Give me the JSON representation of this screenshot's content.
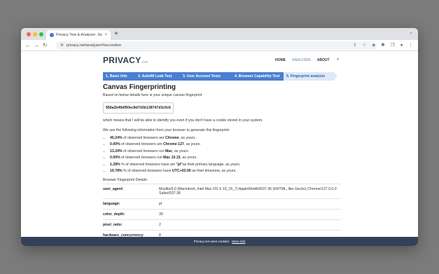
{
  "browser": {
    "tab_title": "Privacy Test & Analyzer: See",
    "tab_close": "×",
    "new_tab": "+",
    "tab_menu": "⌄",
    "back": "←",
    "forward": "→",
    "reload": "↻",
    "url": "privacy.net/analyzer/#accordion",
    "toolbar_icons": [
      "⇪",
      "☆",
      "◈",
      "✱",
      "❐",
      "●",
      "⋮"
    ]
  },
  "site": {
    "logo_main": "PRIVACY",
    "logo_suffix": ".net",
    "nav": [
      {
        "label": "HOME",
        "active": false
      },
      {
        "label": "ANALYZER",
        "active": true
      },
      {
        "label": "ABOUT",
        "active": false
      }
    ],
    "search_glyph": "⌕"
  },
  "steps": [
    "1. Basic Info",
    "2. Autofill Leak Test",
    "3. User Account Tests",
    "4. Browser Capability Test",
    "5. Fingerprint analysis"
  ],
  "content": {
    "title": "Canvas Fingerprinting",
    "intro": "Based on below details here is your unique canvas fingerprint",
    "hash": "956a2b49df50ec8d7d3b138747d3c0c6",
    "identify_note": "which means that I will be able to identify you even if you don't have a cookie stored in your system.",
    "info_note": "We use the following information from your browser to generate this fingerprint:",
    "facts": [
      {
        "pre": "",
        "pct": "40.24%",
        "mid": " of observed browsers are ",
        "val": "Chrome",
        "post": ", as yours."
      },
      {
        "pre": "",
        "pct": "0.00%",
        "mid": " of observed browsers are ",
        "val": "Chrome 127",
        "post": ", as yours."
      },
      {
        "pre": "",
        "pct": "13.24%",
        "mid": " of observed browsers run ",
        "val": "Mac",
        "post": ", as yours."
      },
      {
        "pre": "",
        "pct": "0.00%",
        "mid": " of observed browsers run ",
        "val": "Mac 10.15",
        "post": ", as yours."
      },
      {
        "pre": "",
        "pct": "1.28%",
        "mid": " % of observed browsers have set ",
        "val": "\"pl\"",
        "post": "as their primary language, as yours."
      },
      {
        "pre": "",
        "pct": "19.78%",
        "mid": " % of observed browsers have ",
        "val": "UTC+02:00",
        "post": " as their timezone, as yours."
      }
    ],
    "details_title": "Browser Fingerprint Details:",
    "details": [
      {
        "key": "user_agent:",
        "value": "Mozilla/5.0 (Macintosh; Intel Mac OS X 10_15_7) AppleWebKit/537.36 (KHTML, like Gecko) Chrome/127.0.0.0 Safari/537.36"
      },
      {
        "key": "language:",
        "value": "pl"
      },
      {
        "key": "color_depth:",
        "value": "30"
      },
      {
        "key": "pixel_ratio:",
        "value": "2"
      },
      {
        "key": "hardware_concurrency:",
        "value": "8"
      }
    ]
  },
  "cookie_bar": {
    "text": "Privacy.net uses cookies.",
    "link": "More info"
  },
  "colors": {
    "steps_bg": "#4a7fd2",
    "steps_current_bg": "#dde8f8",
    "cookie_bar_bg": "#34405a"
  }
}
